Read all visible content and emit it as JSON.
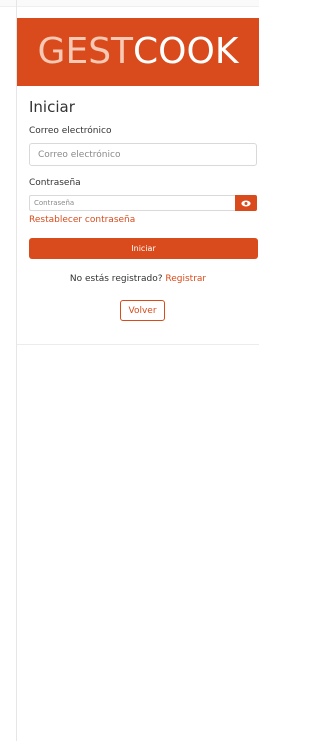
{
  "brand": {
    "part1": "GEST",
    "part2": "COOK"
  },
  "form": {
    "title": "Iniciar",
    "email_label": "Correo electrónico",
    "email_placeholder": "Correo electrónico",
    "password_label": "Contraseña",
    "password_placeholder": "Contraseña",
    "reset_link": "Restablecer contraseña",
    "submit_label": "Iniciar",
    "register_prompt": "No estás registrado?",
    "register_link": "Registrar",
    "back_label": "Volver"
  },
  "icons": {
    "toggle_password": "eye-icon"
  },
  "colors": {
    "accent": "#d94b1c",
    "brand_light": "#f7c8b3"
  }
}
